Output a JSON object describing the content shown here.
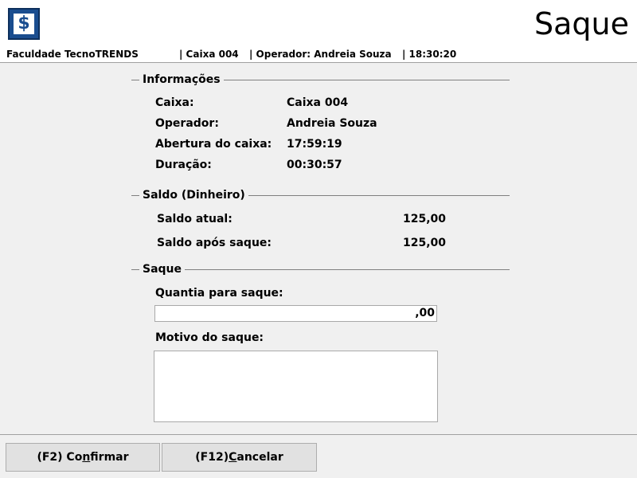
{
  "header": {
    "title": "Saque",
    "logo_icon": "dollar-icon",
    "logo_glyph": "$",
    "colors": {
      "logo": "#1a4d8f",
      "background": "#f0f0f0"
    }
  },
  "statusbar": {
    "company": "Faculdade TecnoTRENDS",
    "caixa": "| Caixa 004",
    "operador": "| Operador: Andreia Souza",
    "time": "| 18:30:20"
  },
  "informacoes": {
    "legend": "Informações",
    "caixa_label": "Caixa:",
    "caixa_value": "Caixa 004",
    "operador_label": "Operador:",
    "operador_value": "Andreia Souza",
    "abertura_label": "Abertura do caixa:",
    "abertura_value": "17:59:19",
    "duracao_label": "Duração:",
    "duracao_value": "00:30:57"
  },
  "saldo": {
    "legend": "Saldo (Dinheiro)",
    "atual_label": "Saldo atual:",
    "atual_value": "125,00",
    "apos_label": "Saldo após saque:",
    "apos_value": "125,00"
  },
  "saque": {
    "legend": "Saque",
    "quantia_label": "Quantia para saque:",
    "quantia_value": ",00",
    "motivo_label": "Motivo do saque:",
    "motivo_value": ""
  },
  "buttons": {
    "confirmar_pre": "(F2) Co",
    "confirmar_key": "n",
    "confirmar_post": "firmar",
    "cancelar_pre": "(F12) ",
    "cancelar_key": "C",
    "cancelar_post": "ancelar"
  }
}
